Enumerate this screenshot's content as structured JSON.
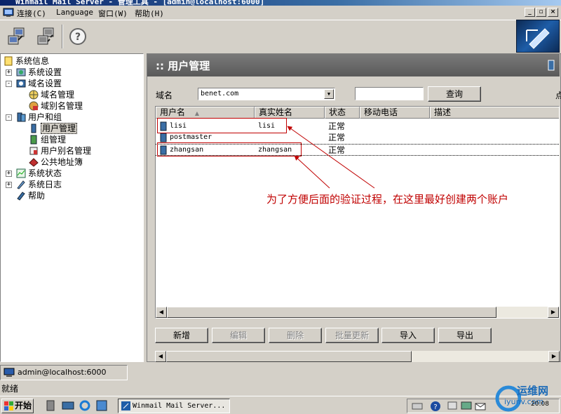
{
  "window": {
    "title": "Winmail Mail Server - 管理工具 - [admin@localhost:6000]"
  },
  "menu": {
    "items": [
      "连接(C)",
      "Language",
      "窗口(W)",
      "帮助(H)"
    ]
  },
  "tree": {
    "items": [
      {
        "label": "系统信息",
        "icon": "info-icon"
      },
      {
        "label": "系统设置",
        "icon": "settings-icon",
        "expander": "+"
      },
      {
        "label": "域名设置",
        "icon": "domain-icon",
        "expander": "-"
      },
      {
        "label": "域名管理",
        "icon": "globe-icon"
      },
      {
        "label": "域别名管理",
        "icon": "globe-alias-icon"
      },
      {
        "label": "用户和组",
        "icon": "users-icon",
        "expander": "-"
      },
      {
        "label": "用户管理",
        "icon": "user-icon",
        "selected": true
      },
      {
        "label": "组管理",
        "icon": "group-icon"
      },
      {
        "label": "用户别名管理",
        "icon": "user-alias-icon"
      },
      {
        "label": "公共地址簿",
        "icon": "address-book-icon"
      },
      {
        "label": "系统状态",
        "icon": "status-icon",
        "expander": "+"
      },
      {
        "label": "系统日志",
        "icon": "log-icon",
        "expander": "+"
      },
      {
        "label": "帮助",
        "icon": "help-book-icon"
      }
    ]
  },
  "panel": {
    "title": ":: 用户管理"
  },
  "filter": {
    "domain_label": "域名",
    "domain_value": "benet.com",
    "search_value": "",
    "query_button": "查询"
  },
  "table": {
    "columns": [
      "用户名",
      "真实姓名",
      "状态",
      "移动电话",
      "描述"
    ],
    "sort_column": "用户名",
    "rows": [
      {
        "username": "lisi",
        "realname": "lisi",
        "status": "正常",
        "mobile": "",
        "desc": ""
      },
      {
        "username": "postmaster",
        "realname": "",
        "status": "正常",
        "mobile": "",
        "desc": ""
      },
      {
        "username": "zhangsan",
        "realname": "zhangsan",
        "status": "正常",
        "mobile": "",
        "desc": ""
      }
    ]
  },
  "annotation": "为了方便后面的验证过程，在这里最好创建两个账户",
  "actions": {
    "add": "新增",
    "edit": "编辑",
    "delete": "删除",
    "batch_update": "批量更新",
    "import": "导入",
    "export": "导出"
  },
  "status": {
    "connection": "admin@localhost:6000",
    "message": "就绪"
  },
  "taskbar": {
    "start": "开始",
    "task": "Winmail Mail Server...",
    "clock": "20:08"
  },
  "watermark": {
    "line1": "运维网",
    "line2": "iyunv.com"
  },
  "colors": {
    "annotation": "#c00000",
    "panel_header": "#6a6a6a",
    "window_bg": "#d4d0c8"
  }
}
